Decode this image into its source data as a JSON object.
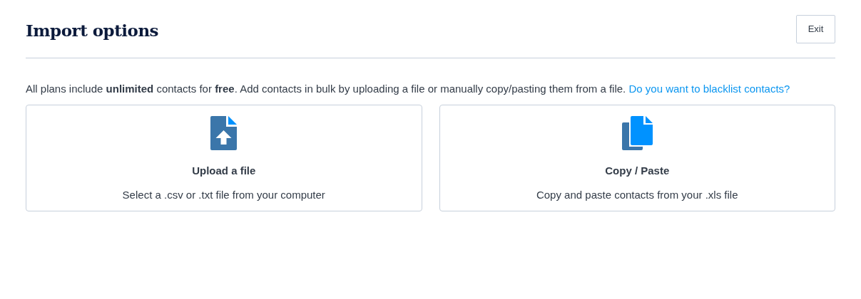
{
  "header": {
    "title": "Import options",
    "exit_button": "Exit"
  },
  "intro": {
    "text": "All plans include **unlimited** contacts for **free**. Add contacts in bulk by uploading a file or manually copy/pasting them from a file.",
    "link": "Do you want to blacklist contacts?"
  },
  "options": [
    {
      "kind": "upload",
      "title": "Upload a file",
      "description": "Select a .csv or .txt file from your computer"
    },
    {
      "kind": "paste",
      "title": "Copy / Paste",
      "description": "Copy and paste contacts from your .xls file"
    }
  ]
}
